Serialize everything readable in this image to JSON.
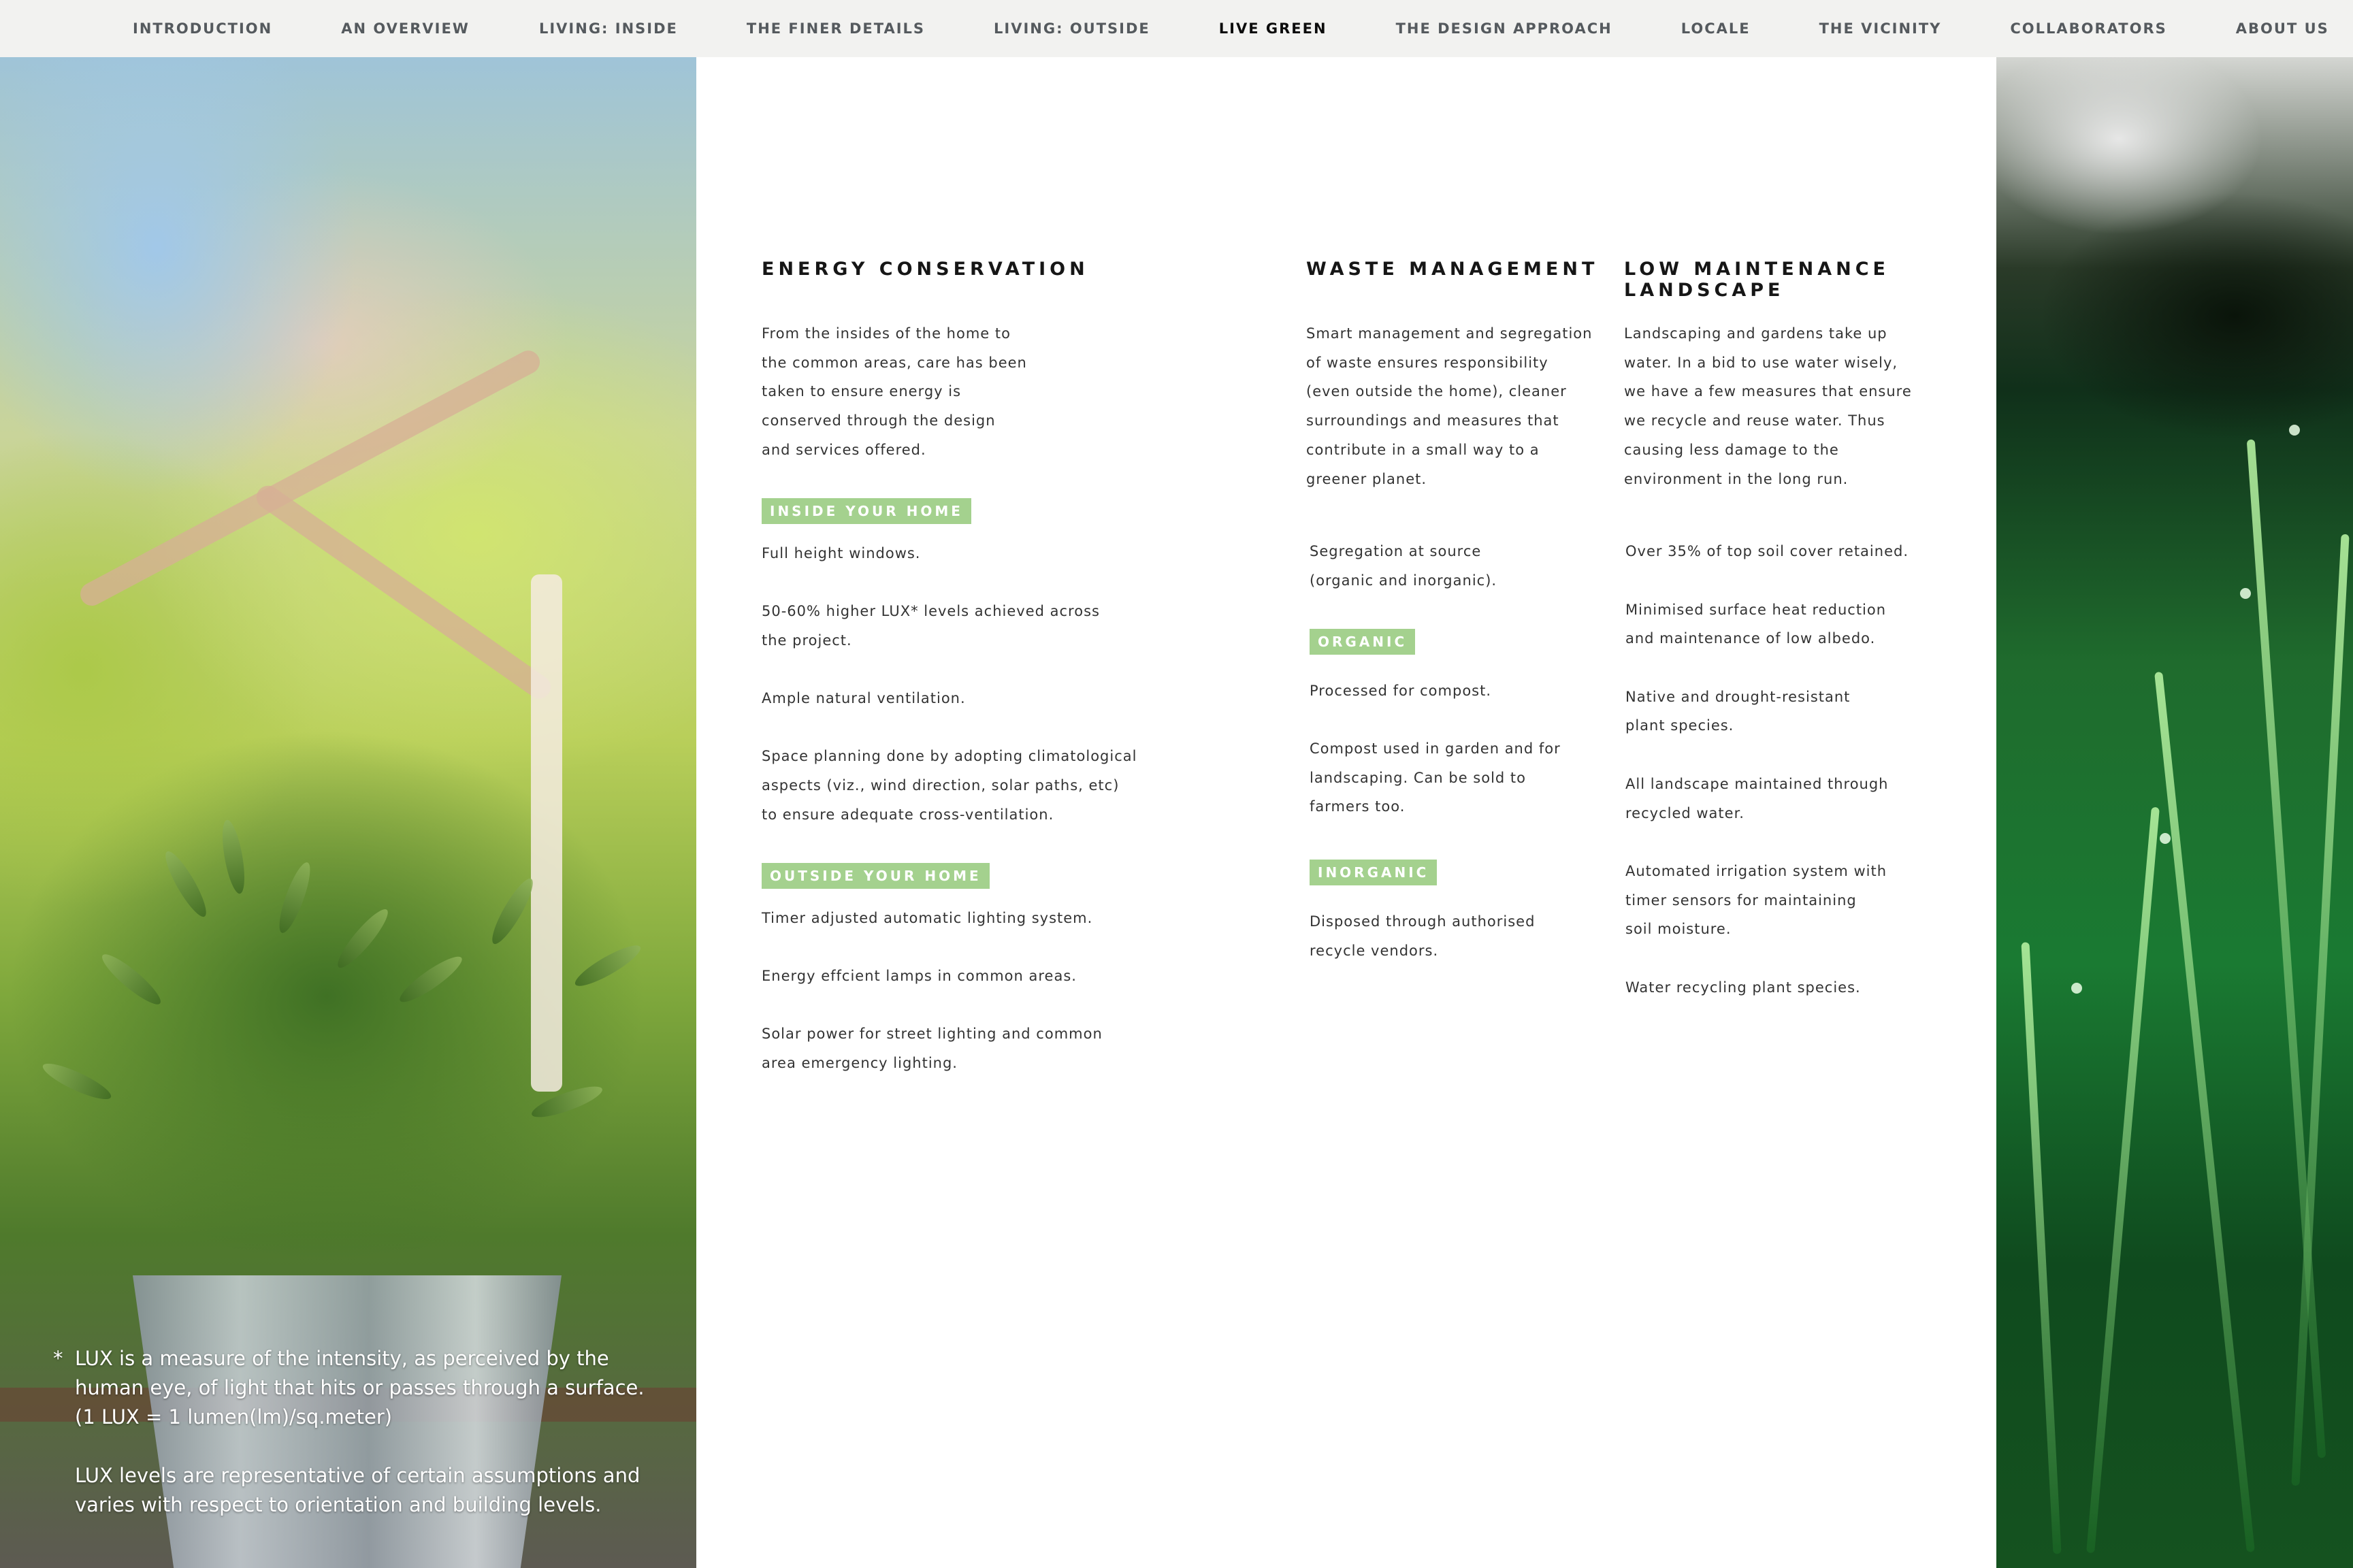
{
  "nav": {
    "items": [
      {
        "label": "INTRODUCTION"
      },
      {
        "label": "AN OVERVIEW"
      },
      {
        "label": "LIVING: INSIDE"
      },
      {
        "label": "THE FINER DETAILS"
      },
      {
        "label": "LIVING: OUTSIDE"
      },
      {
        "label": "LIVE GREEN"
      },
      {
        "label": "THE DESIGN APPROACH"
      },
      {
        "label": "LOCALE"
      },
      {
        "label": "THE VICINITY"
      },
      {
        "label": "COLLABORATORS"
      },
      {
        "label": "ABOUT US"
      }
    ],
    "active": "LIVE GREEN"
  },
  "energy": {
    "title": "ENERGY CONSERVATION",
    "intro": [
      "From the insides of the home to",
      "the common areas, care has been",
      "taken to ensure energy is",
      "conserved through the design",
      "and services offered."
    ],
    "inside_badge": "INSIDE YOUR HOME",
    "inside_items": [
      [
        "Full height windows."
      ],
      [
        "50-60% higher LUX* levels achieved across",
        "the project."
      ],
      [
        "Ample natural ventilation."
      ],
      [
        "Space planning done by adopting climatological",
        "aspects (viz., wind direction, solar paths, etc)",
        "to ensure adequate cross-ventilation."
      ]
    ],
    "outside_badge": "OUTSIDE YOUR HOME",
    "outside_items": [
      [
        "Timer adjusted automatic lighting system."
      ],
      [
        "Energy effcient lamps in common areas."
      ],
      [
        "Solar power for street lighting and common",
        "area emergency lighting."
      ]
    ]
  },
  "waste": {
    "title": "WASTE MANAGEMENT",
    "intro": [
      "Smart management and segregation",
      "of waste ensures responsibility",
      "(even outside the home), cleaner",
      "surroundings and measures that",
      "contribute in a small way to a",
      "greener planet."
    ],
    "segregation": [
      "Segregation at source",
      "(organic and inorganic)."
    ],
    "organic_badge": "ORGANIC",
    "organic_items": [
      [
        "Processed for compost."
      ],
      [
        "Compost used in garden and for",
        "landscaping. Can be sold to",
        "farmers too."
      ]
    ],
    "inorganic_badge": "INORGANIC",
    "inorganic_items": [
      [
        "Disposed through authorised",
        "recycle vendors."
      ]
    ]
  },
  "landscape": {
    "title_line1": "LOW MAINTENANCE",
    "title_line2": "LANDSCAPE",
    "intro": [
      "Landscaping and gardens take up",
      "water. In a bid to use water wisely,",
      "we have a few measures that ensure",
      "we recycle and reuse water. Thus",
      "causing less damage to the",
      "environment in the long run."
    ],
    "items": [
      [
        "Over 35% of top soil cover retained."
      ],
      [
        "Minimised surface heat reduction",
        "and maintenance of low albedo."
      ],
      [
        "Native and drought-resistant",
        "plant species."
      ],
      [
        "All landscape maintained through",
        "recycled water."
      ],
      [
        "Automated irrigation system with",
        "timer sensors for maintaining",
        "soil moisture."
      ],
      [
        "Water recycling plant species."
      ]
    ]
  },
  "footnote": {
    "star": "*",
    "lines1": [
      "LUX is a measure of the intensity, as perceived by the",
      "human eye, of light that hits or passes through a surface.",
      "(1 LUX = 1 lumen(lm)/sq.meter)"
    ],
    "lines2": [
      "LUX levels are representative of certain assumptions and",
      "varies with respect to orientation and building levels."
    ]
  },
  "colors": {
    "badge": "#a4d18e",
    "nav_bg": "#f2f2f0",
    "nav_active": "#0c0c0c",
    "nav_text": "#555a5e"
  }
}
